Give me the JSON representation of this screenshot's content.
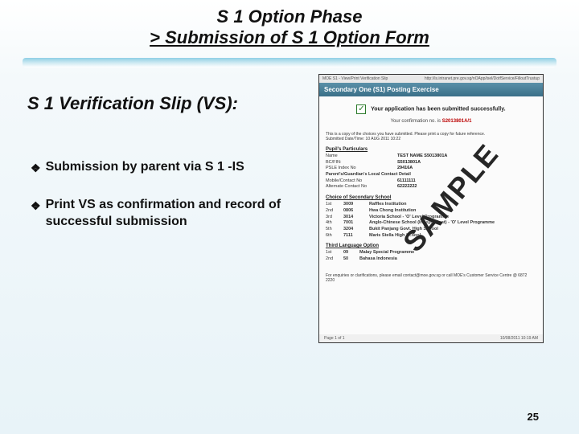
{
  "title": {
    "line1": "S 1 Option Phase",
    "line2": "> Submission of S 1 Option Form"
  },
  "subtitle": "S 1 Verification Slip (VS):",
  "bullets": [
    "Submission by parent via S 1 -IS",
    "Print VS as confirmation and record of successful submission"
  ],
  "watermark": "SAMPLE",
  "page_number": "25",
  "screenshot": {
    "topbar_left": "MOE S1 - View/Print Verification Slip",
    "topbar_right": "http://is.intranet.pre.gov.sg/nOApp/isel/DotfService/FilloutTrustup",
    "header": "Secondary One (S1) Posting Exercise",
    "confirm_text": "Your application has been submitted successfully.",
    "confirm_sub_prefix": "Your confirmation no. is",
    "confirm_number": "S2013801A/1",
    "note_line1": "This is a copy of the choices you have submitted. Please print a copy for future reference.",
    "note_line2": "Submitted Date/Time: 10 AUG 2011 10:22",
    "pupil_section": "Pupil's Particulars",
    "pupil": {
      "name_label": "Name",
      "name": "TEST NAME S5013801A",
      "bcfin_label": "BC/FIN:",
      "bcfin": "S5013801A",
      "psle_label": "PSLE Index No",
      "psle": "29416A",
      "guardian_label": "Parent's/Guardian's Local Contact Detail",
      "mobile_label": "Mobile/Contact No",
      "mobile": "61111111",
      "alt_label": "Alternate Contact No",
      "alt": "62222222"
    },
    "choices_section": "Choice of Secondary School",
    "choices": [
      {
        "ord": "1st",
        "code": "3009",
        "school": "Raffles Institution"
      },
      {
        "ord": "2nd",
        "code": "0806",
        "school": "Hwa Chong Institution"
      },
      {
        "ord": "3rd",
        "code": "3014",
        "school": "Victoria School - 'O' Level Programme"
      },
      {
        "ord": "4th",
        "code": "7001",
        "school": "Anglo-Chinese School (Independent) - 'O' Level Programme"
      },
      {
        "ord": "5th",
        "code": "3204",
        "school": "Bukit Panjang Govt. High School"
      },
      {
        "ord": "6th",
        "code": "7111",
        "school": "Maris Stella High School"
      }
    ],
    "tlp_section": "Third Language Option",
    "tlp": [
      {
        "ord": "1st",
        "code": "09",
        "lang": "Malay Special Programme"
      },
      {
        "ord": "2nd",
        "code": "50",
        "lang": "Bahasa Indonesia"
      }
    ],
    "enquiry": "For enquiries or clarifications, please email contact@moe.gov.sg or call MOE's Customer Service Centre @ 6872 2220",
    "footer_left": "Page 1 of 1",
    "footer_right": "10/08/2011 10:19 AM"
  }
}
